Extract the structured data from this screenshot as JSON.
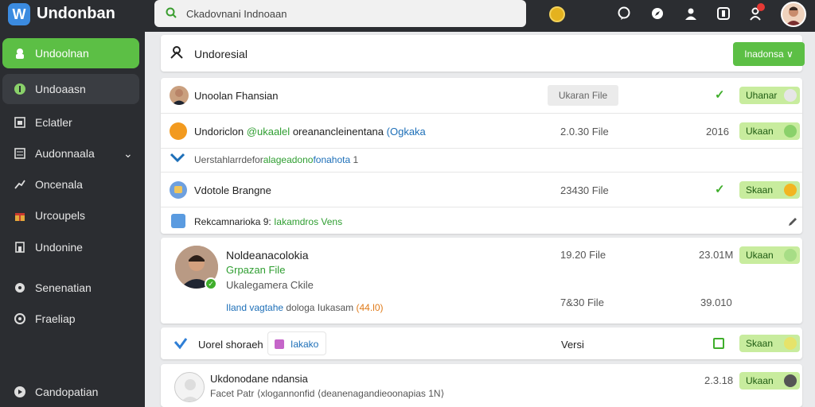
{
  "app": {
    "title": "Undonban",
    "logo_letter": "W"
  },
  "search": {
    "text": "Ckadovnani Indnoaan"
  },
  "topbar": {
    "icons": [
      "coin-icon",
      "chat-icon",
      "compass-icon",
      "user-icon",
      "inbox-icon",
      "notification-icon",
      "avatar"
    ]
  },
  "sidebar": {
    "items": [
      {
        "label": "Undoolnan",
        "icon": "home-icon",
        "state": "active"
      },
      {
        "label": "Undoaasn",
        "icon": "leaf-icon",
        "state": "selected"
      },
      {
        "label": "Eclatler",
        "icon": "calendar-icon"
      },
      {
        "label": "Audonnaala",
        "icon": "list-icon",
        "expandable": true
      },
      {
        "label": "Oncenala",
        "icon": "chart-icon"
      },
      {
        "label": "Urcoupels",
        "icon": "gift-icon"
      },
      {
        "label": "Undonine",
        "icon": "doc-icon"
      },
      {
        "label": "Senenatian",
        "icon": "settings-icon"
      },
      {
        "label": "Fraeliap",
        "icon": "help-icon"
      },
      {
        "label": "Candopatian",
        "icon": "info-icon"
      }
    ]
  },
  "header_card": {
    "title": "Undoresial",
    "button": "Inadonsa ∨"
  },
  "list": {
    "r1": {
      "name": "Unoolan Fhansian",
      "button_gray": "Ukaran File",
      "action": "Uhanar"
    },
    "r2": {
      "name": "Undoriclon",
      "handle": "@ukaalel",
      "desc": "oreanancleinentana",
      "tag": "(Ogkaka",
      "size": "2.0.30 File",
      "year": "2016",
      "action": "Ukaan"
    },
    "r3": {
      "text_a": "Uerstahlarrdefor",
      "text_b": "alageadono",
      "text_c": "fonahota",
      "suffix": "1"
    },
    "r4": {
      "name": "Vdotole Brangne",
      "size": "23430 File",
      "action": "Skaan"
    },
    "r5": {
      "label": "Rekcamnarioka 9:",
      "tag": "Iakamdros Vens"
    }
  },
  "profile_card": {
    "name": "Noldeanacolokia",
    "file_label": "Grpazan File",
    "sub": "Ukalegamera Ckile",
    "line_a": "Iland vagtahe",
    "line_b": "dologa Iukasam",
    "line_c": "(44.l0)",
    "size1": "19.20 File",
    "size2": "7&30 File",
    "meta1": "23.01M",
    "meta2": "39.010",
    "action": "Ukaan"
  },
  "share_card": {
    "label": "Uorel shoraeh",
    "chip": "Iakako",
    "mid": "Versi",
    "action": "Skaan"
  },
  "bottom_card": {
    "name": "Ukdonodane ndansia",
    "sub": "Facet Patr ⟨xlogannonfid ⟨deanenagandieoonapias 1N⟩",
    "meta": "2.3.18",
    "action": "Ukaan"
  }
}
